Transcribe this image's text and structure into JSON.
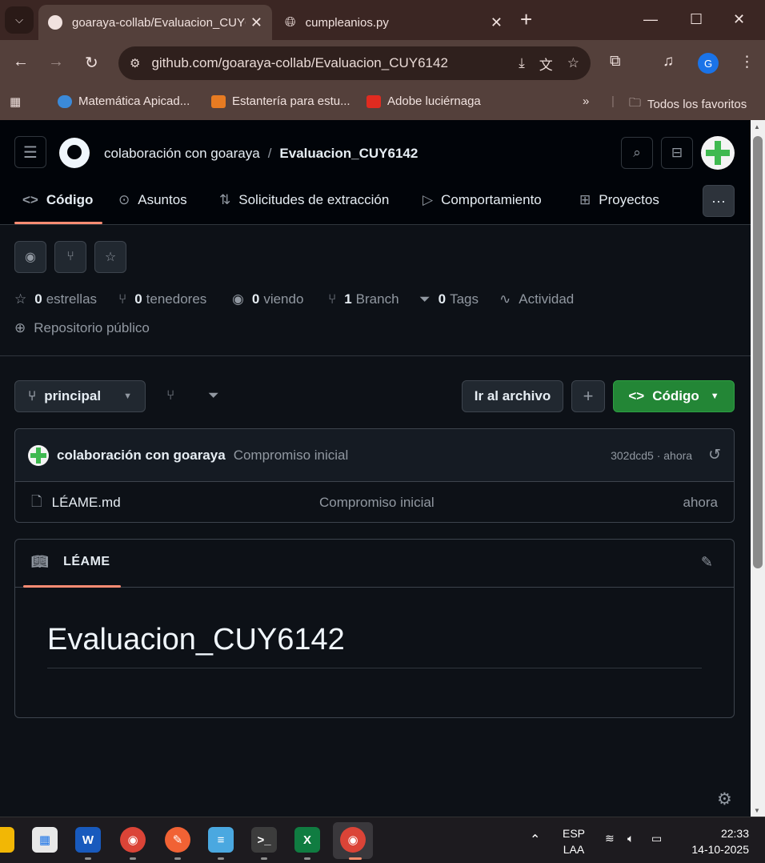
{
  "browser": {
    "tabs": [
      {
        "title": "goaraya-collab/Evaluacion_CUY6142"
      },
      {
        "title": "cumpleanios.py"
      }
    ],
    "url": "github.com/goaraya-collab/Evaluacion_CUY6142",
    "profile_initial": "G",
    "bookmarks": [
      {
        "label": "Matemática Apicad..."
      },
      {
        "label": "Estantería para estu..."
      },
      {
        "label": "Adobe luciérnaga"
      }
    ],
    "all_favorites": "Todos los favoritos"
  },
  "repo_header": {
    "owner": "colaboración con goaraya",
    "separator": "/",
    "repo": "Evaluacion_CUY6142"
  },
  "nav_tabs": [
    {
      "label": "Código",
      "icon": "code-icon"
    },
    {
      "label": "Asuntos",
      "icon": "issue-icon"
    },
    {
      "label": "Solicitudes de extracción",
      "icon": "pull-request-icon"
    },
    {
      "label": "Comportamiento",
      "icon": "play-icon"
    },
    {
      "label": "Proyectos",
      "icon": "table-icon"
    }
  ],
  "stats": {
    "stars_count": "0",
    "stars_label": "estrellas",
    "forks_count": "0",
    "forks_label": "tenedores",
    "watching_count": "0",
    "watching_label": "viendo",
    "branch_count": "1",
    "branch_label": "Branch",
    "tags_count": "0",
    "tags_label": "Tags",
    "activity_label": "Actividad",
    "visibility": "Repositorio público"
  },
  "file_nav": {
    "branch": "principal",
    "go_to_file": "Ir al archivo",
    "add": "+",
    "code_button": "Código"
  },
  "latest_commit": {
    "author": "colaboración con goaraya",
    "message": "Compromiso inicial",
    "sha_time": "302dcd5 · ahora"
  },
  "files": [
    {
      "name": "LÉAME.md",
      "message": "Compromiso inicial",
      "time": "ahora"
    }
  ],
  "readme": {
    "tab_label": "LÉAME",
    "heading": "Evaluacion_CUY6142"
  },
  "taskbar": {
    "lang": "ESP",
    "layout": "LAA",
    "time": "22:33",
    "date": "14-10-2025"
  },
  "colors": {
    "accent_underline": "#fd8c73",
    "primary_button": "#238636",
    "page_background": "#0d1117",
    "chrome_toolbar": "#54403b"
  }
}
